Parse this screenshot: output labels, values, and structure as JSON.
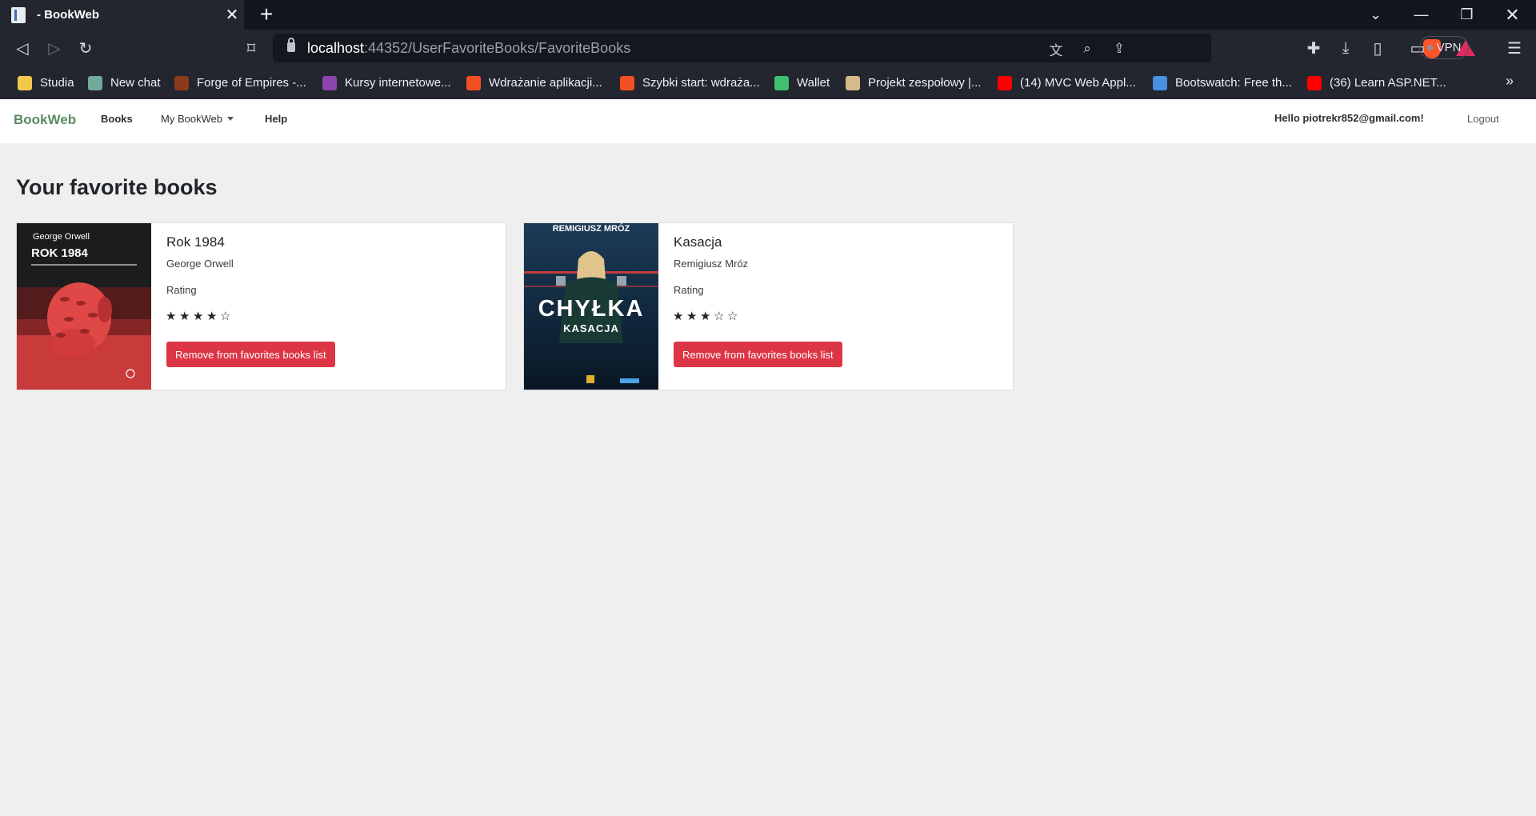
{
  "browser": {
    "tab_title": "- BookWeb",
    "tab_close": "✕",
    "new_tab": "+",
    "url_host": "localhost",
    "url_rest": ":44352/UserFavoriteBooks/FavoriteBooks",
    "vpn_label": "VPN",
    "bookmarks": [
      {
        "label": "Studia",
        "color": "#f2c94c"
      },
      {
        "label": "New chat",
        "color": "#74aa9c"
      },
      {
        "label": "Forge of Empires -...",
        "color": "#8b3a1a"
      },
      {
        "label": "Kursy internetowe...",
        "color": "#8e44ad"
      },
      {
        "label": "Wdrażanie aplikacji...",
        "color": "#f25022"
      },
      {
        "label": "Szybki start: wdraża...",
        "color": "#f25022"
      },
      {
        "label": "Wallet",
        "color": "#3fbf6f"
      },
      {
        "label": "Projekt zespołowy |...",
        "color": "#d6b98c"
      },
      {
        "label": "(14) MVC Web Appl...",
        "color": "#ff0000"
      },
      {
        "label": "Bootswatch: Free th...",
        "color": "#4a90e2"
      },
      {
        "label": "(36) Learn ASP.NET...",
        "color": "#ff0000"
      }
    ],
    "bookmarks_more": "»"
  },
  "navbar": {
    "brand": "BookWeb",
    "books": "Books",
    "my_bookweb": "My BookWeb",
    "help": "Help",
    "hello": "Hello piotrekr852@gmail.com!",
    "logout": "Logout"
  },
  "main": {
    "heading": "Your favorite books",
    "books": [
      {
        "title": "Rok 1984",
        "author": "George Orwell",
        "rating_label": "Rating",
        "rating": 4,
        "max_rating": 5,
        "remove_label": "Remove from favorites books list",
        "cover": {
          "author_text": "George Orwell",
          "title_text": "ROK 1984",
          "bg": "#1c1c1c",
          "accent": "#d84545"
        }
      },
      {
        "title": "Kasacja",
        "author": "Remigiusz Mróz",
        "rating_label": "Rating",
        "rating": 3,
        "max_rating": 5,
        "remove_label": "Remove from favorites books list",
        "cover": {
          "author_text": "REMIGIUSZ MRÓZ",
          "title_text": "CHYŁKA",
          "subtitle_text": "KASACJA",
          "bg": "#14283d",
          "accent": "#1e4c6e"
        }
      }
    ]
  }
}
